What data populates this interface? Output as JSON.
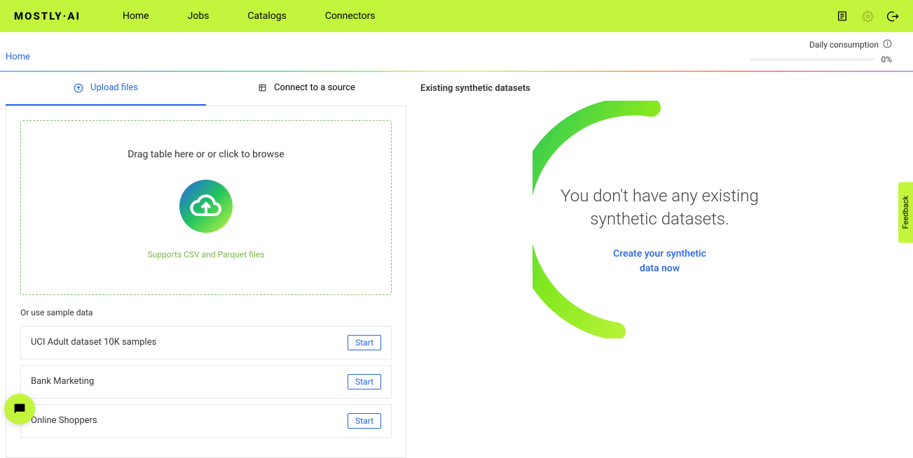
{
  "logo": "MOSTLY·AI",
  "nav": [
    "Home",
    "Jobs",
    "Catalogs",
    "Connectors"
  ],
  "breadcrumb": "Home",
  "consumption": {
    "label": "Daily consumption",
    "value": "0%"
  },
  "tabs": {
    "upload": "Upload files",
    "connect": "Connect to a source"
  },
  "dropzone": {
    "title": "Drag table here or or click to browse",
    "subtitle": "Supports CSV and Parquet files"
  },
  "sample": {
    "label": "Or use sample data",
    "items": [
      "UCI Adult dataset 10K samples",
      "Bank Marketing",
      "Online Shoppers"
    ],
    "button": "Start"
  },
  "right": {
    "title": "Existing synthetic datasets",
    "empty_line1": "You don't have any existing",
    "empty_line2": "synthetic datasets.",
    "link": "Create your synthetic data now"
  },
  "feedback": "Feedback"
}
